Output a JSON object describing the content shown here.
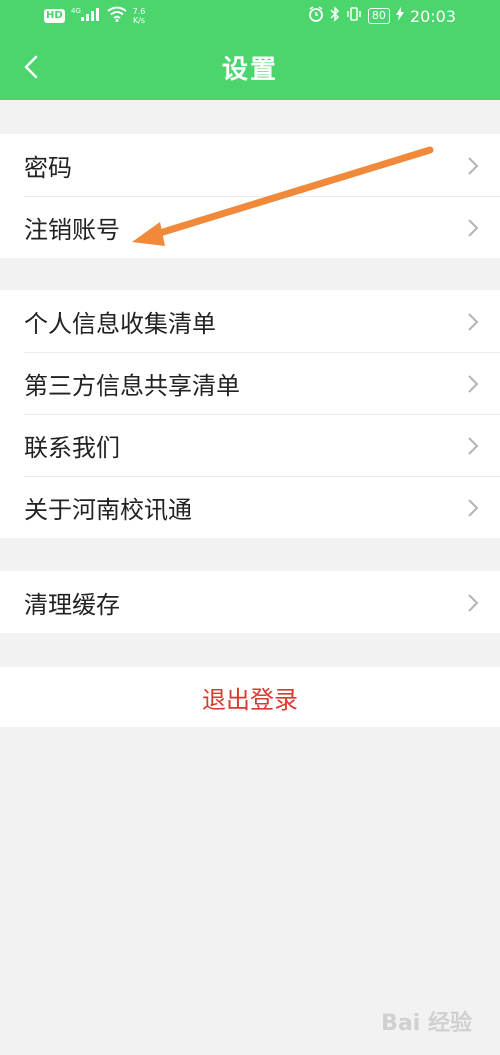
{
  "status_bar": {
    "left_badge": "HD",
    "network": "4G",
    "speed_value": "7.6",
    "speed_unit": "K/s",
    "battery": "80",
    "time": "20:03"
  },
  "nav": {
    "title": "设置",
    "back_icon": "chevron-left-icon"
  },
  "groups": [
    {
      "items": [
        {
          "label": "密码"
        },
        {
          "label": "注销账号"
        }
      ]
    },
    {
      "items": [
        {
          "label": "个人信息收集清单"
        },
        {
          "label": "第三方信息共享清单"
        },
        {
          "label": "联系我们"
        },
        {
          "label": "关于河南校讯通"
        }
      ]
    },
    {
      "items": [
        {
          "label": "清理缓存"
        }
      ]
    }
  ],
  "logout": {
    "label": "退出登录"
  },
  "annotation": {
    "type": "arrow",
    "color": "#f0893a",
    "points_to": "注销账号"
  },
  "watermark": {
    "text": "Bai 经验"
  },
  "colors": {
    "header": "#4cd56d",
    "logout_text": "#d93a2f",
    "background": "#f2f2f2"
  }
}
